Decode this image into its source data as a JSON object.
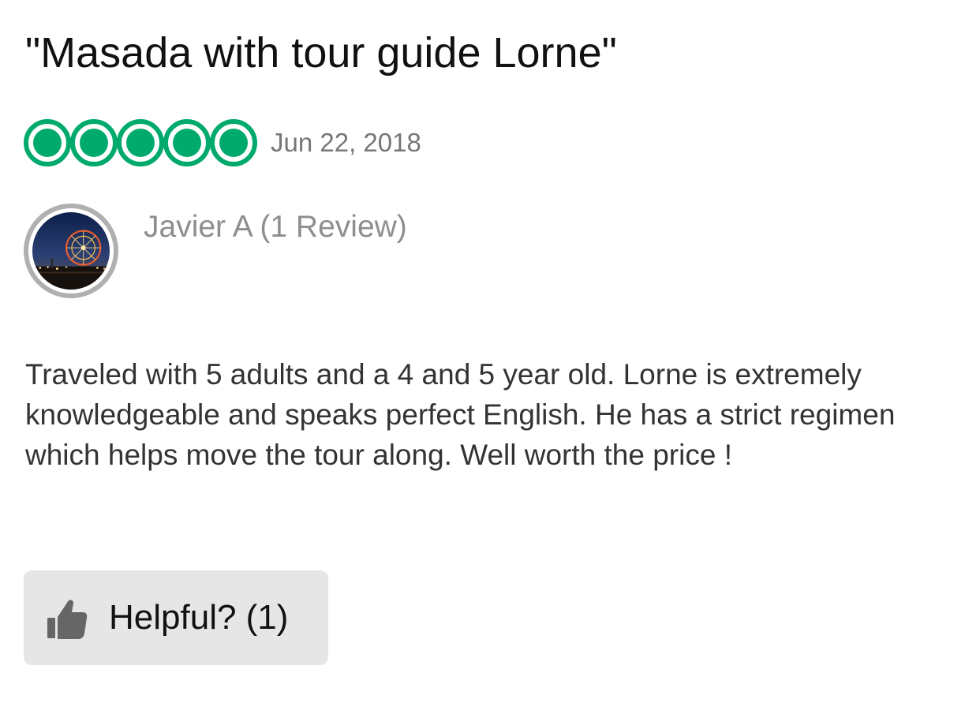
{
  "review": {
    "title": "\"Masada with tour guide Lorne\"",
    "rating": {
      "value": 5,
      "max": 5,
      "icon": "rating-bubble-icon",
      "color": "#00aa6c"
    },
    "date": "Jun 22, 2018",
    "reviewer": {
      "name_line": "Javier A (1 Review)",
      "avatar_icon": "ferris-wheel-night-photo"
    },
    "body": "Traveled with 5 adults and a 4 and 5 year old. Lorne is extremely knowledgeable and speaks perfect English. He has a strict regimen which helps move the tour along. Well worth the price !",
    "helpful_button": {
      "label": "Helpful? (1)",
      "icon": "thumbs-up-icon"
    }
  }
}
